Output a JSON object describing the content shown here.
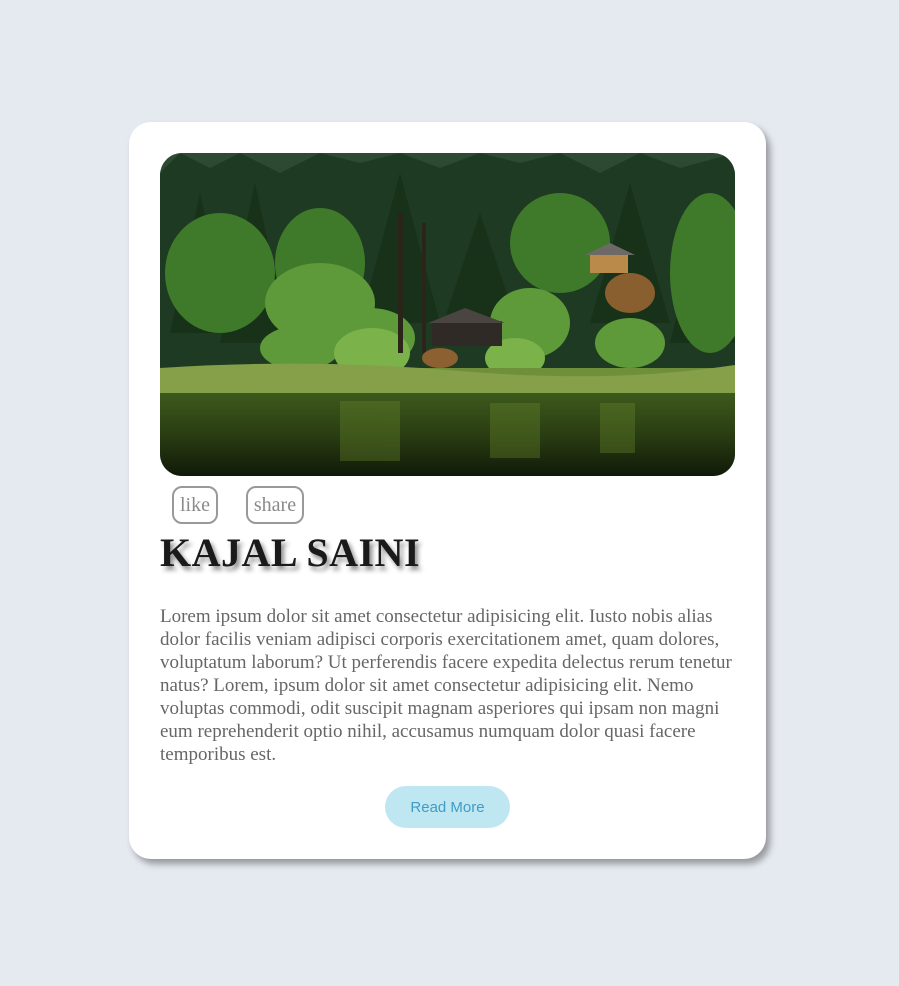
{
  "card": {
    "hero_image": "forest-lake-landscape-photo",
    "actions": {
      "like_label": "like",
      "share_label": "share"
    },
    "title": "KAJAL SAINI",
    "description": "Lorem ipsum dolor sit amet consectetur adipisicing elit. Iusto nobis alias dolor facilis veniam adipisci corporis exercitationem amet, quam dolores, voluptatum laborum? Ut perferendis facere expedita delectus rerum tenetur natus? Lorem, ipsum dolor sit amet consectetur adipisicing elit. Nemo voluptas commodi, odit suscipit magnam asperiores qui ipsam non magni eum reprehenderit optio nihil, accusamus numquam dolor quasi facere temporibus est.",
    "read_more_label": "Read More"
  },
  "colors": {
    "page_background": "#e5e9f0",
    "card_background": "#ffffff",
    "button_background": "#bfe7f1",
    "button_text": "#3f9cc6"
  }
}
